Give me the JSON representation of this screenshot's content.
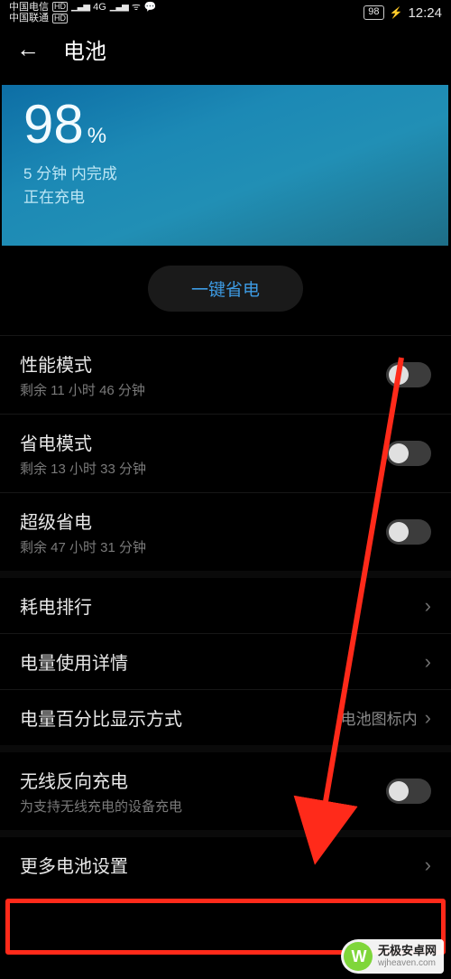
{
  "status_bar": {
    "carrier1": "中国电信",
    "carrier2": "中国联通",
    "hd": "HD",
    "sig_4g": "4G",
    "battery_pct": "98",
    "time": "12:24"
  },
  "header": {
    "title": "电池"
  },
  "battery_card": {
    "pct_number": "98",
    "pct_sign": "%",
    "eta_line": "5 分钟 内完成",
    "status_line": "正在充电"
  },
  "onekey": {
    "label": "一键省电"
  },
  "modes": {
    "performance": {
      "label": "性能模式",
      "sub": "剩余 11 小时 46 分钟"
    },
    "saver": {
      "label": "省电模式",
      "sub": "剩余 13 小时 33 分钟"
    },
    "ultra": {
      "label": "超级省电",
      "sub": "剩余 47 小时 31 分钟"
    }
  },
  "links": {
    "usage_rank": {
      "label": "耗电排行"
    },
    "usage_detail": {
      "label": "电量使用详情"
    },
    "pct_display": {
      "label": "电量百分比显示方式",
      "value": "电池图标内"
    }
  },
  "wireless_reverse": {
    "label": "无线反向充电",
    "sub": "为支持无线充电的设备充电"
  },
  "more_settings": {
    "label": "更多电池设置"
  },
  "watermark": {
    "brand": "无极安卓网",
    "domain": "wjheaven.com"
  }
}
